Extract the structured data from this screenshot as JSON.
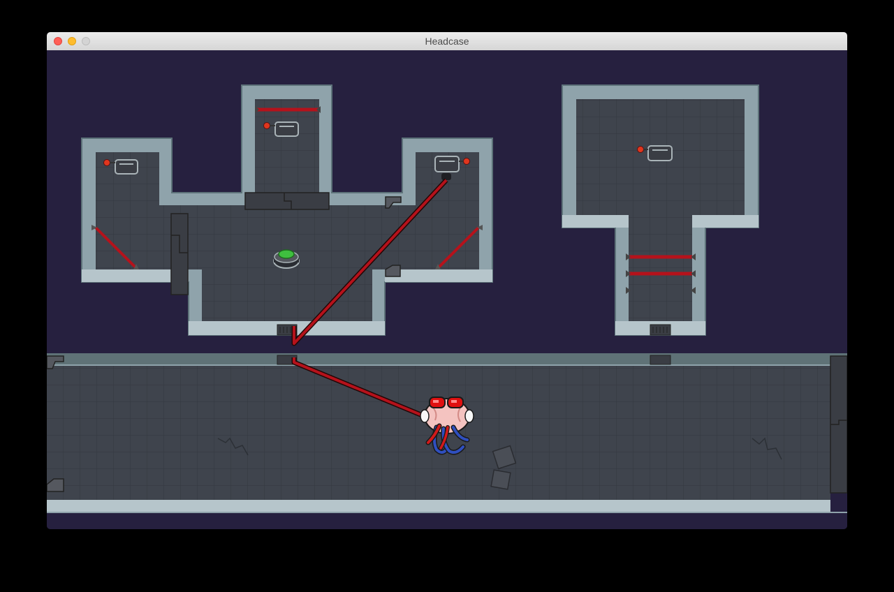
{
  "window": {
    "title": "Headcase",
    "buttons": [
      "close",
      "minimize",
      "zoom"
    ]
  },
  "game": {
    "background_color": "#26203f",
    "floor_color": "#3f444d",
    "wall_color": "#8fa3ab",
    "laser_color": "#b5121b",
    "pressure_button_color": "#3fbf3f",
    "player": {
      "sprite": "brain-octopus-icon",
      "eye_color": "#e01010",
      "tentacle_color": "#2f4fbf"
    },
    "entities": [
      "laser-turret-icon",
      "laser-turret-icon",
      "laser-turret-icon",
      "laser-turret-icon",
      "laser-turret-icon",
      "green-pressure-button-icon",
      "security-camera-icon",
      "floor-vent-icon",
      "sliding-door-icon",
      "crate-debris-icon"
    ]
  }
}
